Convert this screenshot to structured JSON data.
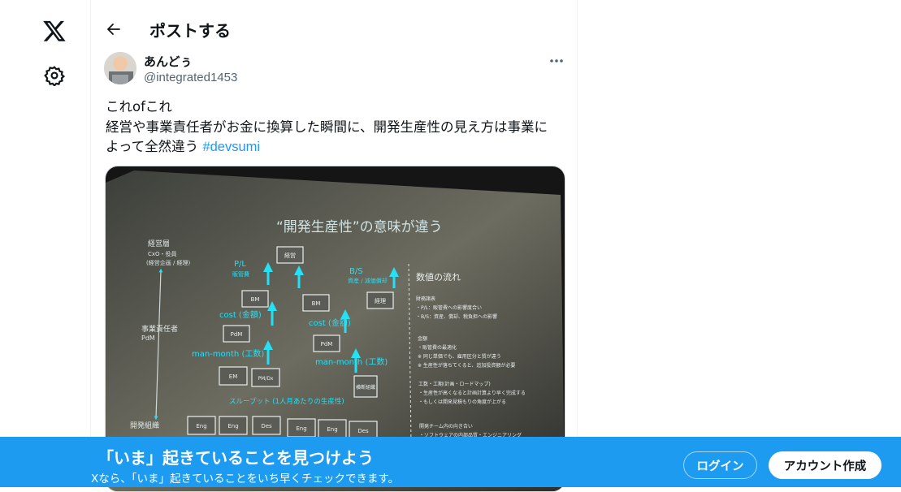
{
  "header": {
    "title": "ポストする"
  },
  "author": {
    "name": "あんどぅ",
    "handle": "@integrated1453"
  },
  "post": {
    "line1": "これofこれ",
    "line2": "経営や事業責任者がお金に換算した瞬間に、開発生産性の見え方は事業に",
    "line3": "よって全然違う",
    "hashtag": "#devsumi"
  },
  "slide": {
    "title": "“開発生産性”の意味が違う",
    "left_top": "経営層",
    "left_top2": "CxO・役員",
    "left_top3": "(経営企画 / 経理)",
    "left_mid": "事業責任者",
    "left_mid2": "PdM",
    "left_bottom": "開発組織",
    "pl": "P/L",
    "pl_sub": "販管費",
    "bs": "B/S",
    "bs_sub": "資産 / 減価償却",
    "keiei": "経営",
    "bm": "BM",
    "bm2": "BM",
    "keiri": "経理",
    "cost": "cost (金額)",
    "cost2": "cost (金額)",
    "pdm": "PdM",
    "pdm2": "PdM",
    "manmonth": "man-month (工数)",
    "manmonth2": "man-month (工数)",
    "em": "EM",
    "pmdx": "PM/Dx",
    "yokodan": "横断組織",
    "throughput": "スループット (1人月あたりの生産性)",
    "eng1": "Eng",
    "eng2": "Eng",
    "des1": "Des",
    "eng3": "Eng",
    "eng4": "Eng",
    "des2": "Des",
    "right_title": "数値の流れ",
    "r1": "財務諸表",
    "r2": "・P/L：販管費への影響度合い",
    "r3": "・B/S：資産、償却、税負担への影響",
    "r4": "金額",
    "r5": "・販管費の最適化",
    "r6": "※ 同じ単価でも、雇用区分と質が違う",
    "r7": "※ 生産性が落ちてくると、追加投資額が必要",
    "r8": "工数・工期(計画・ロードマップ)",
    "r9": "・生産性が高くなると計画計算より早く完成する",
    "r10": "・もしくは開発見積もりの角度が上がる",
    "r11": "開発チーム内の向き合い",
    "r12": "・ソフトウェアの内部品質・エンジニアリング"
  },
  "banner": {
    "title": "「いま」起きていることを見つけよう",
    "subtitle": "Xなら、「いま」起きていることをいち早くチェックできます。",
    "login": "ログイン",
    "signup": "アカウント作成"
  },
  "colors": {
    "accent": "#1d9bf0",
    "slide_text": "#1ed5f0"
  },
  "icons": [
    "x-logo-icon",
    "gear-icon",
    "back-arrow-icon",
    "more-icon"
  ]
}
